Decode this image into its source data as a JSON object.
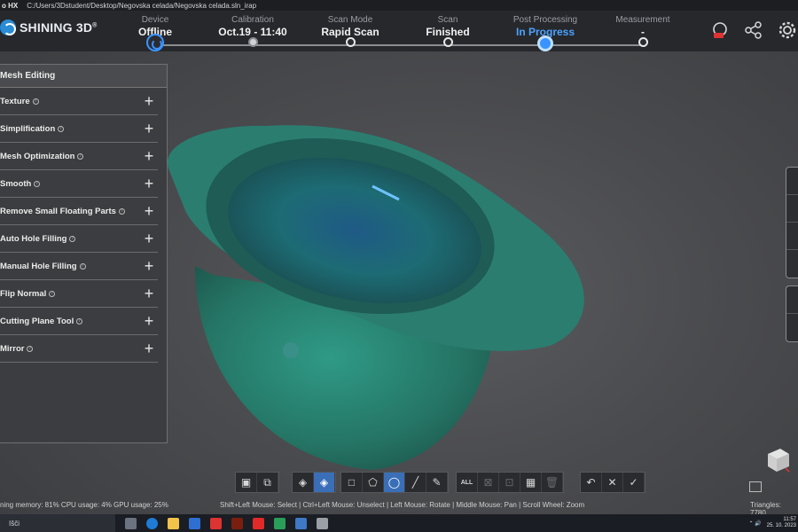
{
  "titlebar": {
    "app": "o HX",
    "path": "C:/Users/3Dstudent/Desktop/Negovska celada/Negovska celada.sln_irap"
  },
  "header": {
    "logo": "SHINING 3D",
    "logo_mark": "®",
    "steps": [
      {
        "label": "Device",
        "value": "Offline",
        "state": "current-icon"
      },
      {
        "label": "Calibration",
        "value": "Oct.19 - 11:40",
        "state": "filled"
      },
      {
        "label": "Scan Mode",
        "value": "Rapid Scan",
        "state": "done"
      },
      {
        "label": "Scan",
        "value": "Finished",
        "state": "done"
      },
      {
        "label": "Post Processing",
        "value": "In Progress",
        "state": "active"
      },
      {
        "label": "Measurement",
        "value": "-",
        "state": "done"
      }
    ],
    "icons": [
      "support-icon",
      "share-icon",
      "settings-icon"
    ]
  },
  "panel": {
    "title": "Mesh Editing",
    "items": [
      {
        "label": "Texture"
      },
      {
        "label": "Simplification"
      },
      {
        "label": "Mesh Optimization"
      },
      {
        "label": "Smooth"
      },
      {
        "label": "Remove Small Floating Parts"
      },
      {
        "label": "Auto Hole Filling"
      },
      {
        "label": "Manual Hole Filling"
      },
      {
        "label": "Flip Normal"
      },
      {
        "label": "Cutting Plane Tool"
      },
      {
        "label": "Mirror"
      }
    ]
  },
  "toolbar": {
    "all_label": "ALL"
  },
  "status": {
    "left": "ning memory: 81% CPU usage: 4% GPU usage: 25%",
    "center": "Shift+Left Mouse: Select | Ctrl+Left Mouse: Unselect | Left Mouse: Rotate | Middle Mouse: Pan | Scroll Wheel: Zoom",
    "right": "Triangles: 7780"
  },
  "taskbar": {
    "search": "Išči",
    "time": "11:57",
    "date": "25. 10. 2023"
  },
  "colors": {
    "accent": "#3a93ff",
    "header": "#27282c",
    "panel": "#3c3d40",
    "helmet": "#2f8a7c"
  }
}
